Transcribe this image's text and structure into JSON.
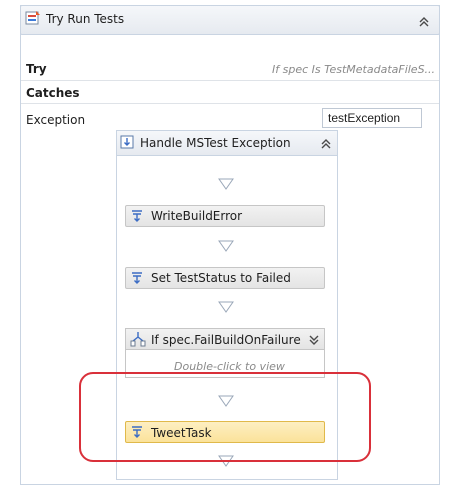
{
  "outer": {
    "title": "Try Run Tests",
    "try_label": "Try",
    "try_condition": "If spec Is TestMetadataFileS...",
    "catches_label": "Catches",
    "exception_label": "Exception",
    "exception_value": "testException"
  },
  "sequence": {
    "title": "Handle MSTest Exception",
    "activities": [
      {
        "label": "WriteBuildError"
      },
      {
        "label": "Set TestStatus to Failed"
      },
      {
        "label": "TweetTask"
      }
    ],
    "if_activity": {
      "label": "If spec.FailBuildOnFailure",
      "hint": "Double-click to view"
    }
  },
  "colors": {
    "highlight_fill": "#fbe29a",
    "annotation_outline": "#d9303a",
    "border": "#c9d4e2"
  },
  "icons": {
    "try_catch": "try-catch-icon",
    "sequence": "sequence-icon",
    "activity": "activity-arrow-icon",
    "if": "if-branch-icon",
    "collapse": "double-chevron-up-icon",
    "expand": "double-chevron-down-icon",
    "flow": "flow-arrow-icon"
  }
}
